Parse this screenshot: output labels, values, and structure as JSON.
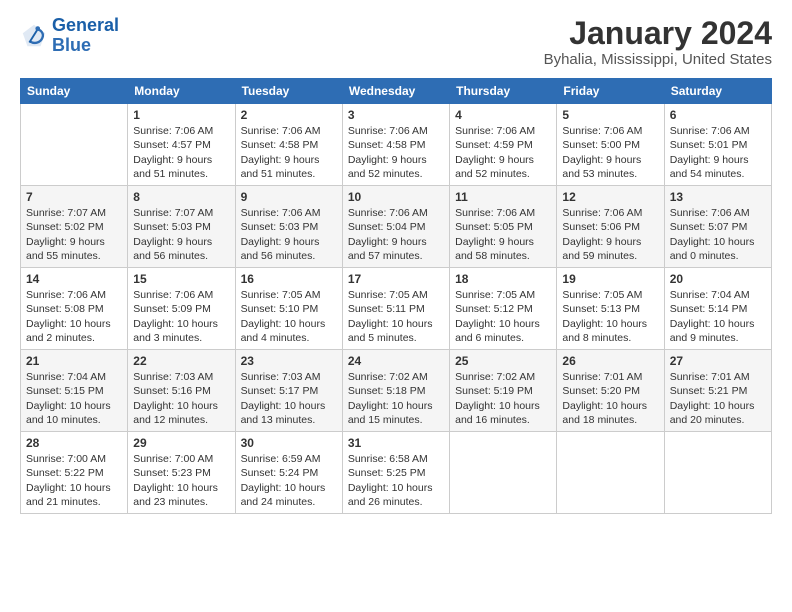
{
  "header": {
    "logo_line1": "General",
    "logo_line2": "Blue",
    "title": "January 2024",
    "subtitle": "Byhalia, Mississippi, United States"
  },
  "days_of_week": [
    "Sunday",
    "Monday",
    "Tuesday",
    "Wednesday",
    "Thursday",
    "Friday",
    "Saturday"
  ],
  "weeks": [
    [
      {
        "day": "",
        "sunrise": "",
        "sunset": "",
        "daylight": ""
      },
      {
        "day": "1",
        "sunrise": "Sunrise: 7:06 AM",
        "sunset": "Sunset: 4:57 PM",
        "daylight": "Daylight: 9 hours and 51 minutes."
      },
      {
        "day": "2",
        "sunrise": "Sunrise: 7:06 AM",
        "sunset": "Sunset: 4:58 PM",
        "daylight": "Daylight: 9 hours and 51 minutes."
      },
      {
        "day": "3",
        "sunrise": "Sunrise: 7:06 AM",
        "sunset": "Sunset: 4:58 PM",
        "daylight": "Daylight: 9 hours and 52 minutes."
      },
      {
        "day": "4",
        "sunrise": "Sunrise: 7:06 AM",
        "sunset": "Sunset: 4:59 PM",
        "daylight": "Daylight: 9 hours and 52 minutes."
      },
      {
        "day": "5",
        "sunrise": "Sunrise: 7:06 AM",
        "sunset": "Sunset: 5:00 PM",
        "daylight": "Daylight: 9 hours and 53 minutes."
      },
      {
        "day": "6",
        "sunrise": "Sunrise: 7:06 AM",
        "sunset": "Sunset: 5:01 PM",
        "daylight": "Daylight: 9 hours and 54 minutes."
      }
    ],
    [
      {
        "day": "7",
        "sunrise": "Sunrise: 7:07 AM",
        "sunset": "Sunset: 5:02 PM",
        "daylight": "Daylight: 9 hours and 55 minutes."
      },
      {
        "day": "8",
        "sunrise": "Sunrise: 7:07 AM",
        "sunset": "Sunset: 5:03 PM",
        "daylight": "Daylight: 9 hours and 56 minutes."
      },
      {
        "day": "9",
        "sunrise": "Sunrise: 7:06 AM",
        "sunset": "Sunset: 5:03 PM",
        "daylight": "Daylight: 9 hours and 56 minutes."
      },
      {
        "day": "10",
        "sunrise": "Sunrise: 7:06 AM",
        "sunset": "Sunset: 5:04 PM",
        "daylight": "Daylight: 9 hours and 57 minutes."
      },
      {
        "day": "11",
        "sunrise": "Sunrise: 7:06 AM",
        "sunset": "Sunset: 5:05 PM",
        "daylight": "Daylight: 9 hours and 58 minutes."
      },
      {
        "day": "12",
        "sunrise": "Sunrise: 7:06 AM",
        "sunset": "Sunset: 5:06 PM",
        "daylight": "Daylight: 9 hours and 59 minutes."
      },
      {
        "day": "13",
        "sunrise": "Sunrise: 7:06 AM",
        "sunset": "Sunset: 5:07 PM",
        "daylight": "Daylight: 10 hours and 0 minutes."
      }
    ],
    [
      {
        "day": "14",
        "sunrise": "Sunrise: 7:06 AM",
        "sunset": "Sunset: 5:08 PM",
        "daylight": "Daylight: 10 hours and 2 minutes."
      },
      {
        "day": "15",
        "sunrise": "Sunrise: 7:06 AM",
        "sunset": "Sunset: 5:09 PM",
        "daylight": "Daylight: 10 hours and 3 minutes."
      },
      {
        "day": "16",
        "sunrise": "Sunrise: 7:05 AM",
        "sunset": "Sunset: 5:10 PM",
        "daylight": "Daylight: 10 hours and 4 minutes."
      },
      {
        "day": "17",
        "sunrise": "Sunrise: 7:05 AM",
        "sunset": "Sunset: 5:11 PM",
        "daylight": "Daylight: 10 hours and 5 minutes."
      },
      {
        "day": "18",
        "sunrise": "Sunrise: 7:05 AM",
        "sunset": "Sunset: 5:12 PM",
        "daylight": "Daylight: 10 hours and 6 minutes."
      },
      {
        "day": "19",
        "sunrise": "Sunrise: 7:05 AM",
        "sunset": "Sunset: 5:13 PM",
        "daylight": "Daylight: 10 hours and 8 minutes."
      },
      {
        "day": "20",
        "sunrise": "Sunrise: 7:04 AM",
        "sunset": "Sunset: 5:14 PM",
        "daylight": "Daylight: 10 hours and 9 minutes."
      }
    ],
    [
      {
        "day": "21",
        "sunrise": "Sunrise: 7:04 AM",
        "sunset": "Sunset: 5:15 PM",
        "daylight": "Daylight: 10 hours and 10 minutes."
      },
      {
        "day": "22",
        "sunrise": "Sunrise: 7:03 AM",
        "sunset": "Sunset: 5:16 PM",
        "daylight": "Daylight: 10 hours and 12 minutes."
      },
      {
        "day": "23",
        "sunrise": "Sunrise: 7:03 AM",
        "sunset": "Sunset: 5:17 PM",
        "daylight": "Daylight: 10 hours and 13 minutes."
      },
      {
        "day": "24",
        "sunrise": "Sunrise: 7:02 AM",
        "sunset": "Sunset: 5:18 PM",
        "daylight": "Daylight: 10 hours and 15 minutes."
      },
      {
        "day": "25",
        "sunrise": "Sunrise: 7:02 AM",
        "sunset": "Sunset: 5:19 PM",
        "daylight": "Daylight: 10 hours and 16 minutes."
      },
      {
        "day": "26",
        "sunrise": "Sunrise: 7:01 AM",
        "sunset": "Sunset: 5:20 PM",
        "daylight": "Daylight: 10 hours and 18 minutes."
      },
      {
        "day": "27",
        "sunrise": "Sunrise: 7:01 AM",
        "sunset": "Sunset: 5:21 PM",
        "daylight": "Daylight: 10 hours and 20 minutes."
      }
    ],
    [
      {
        "day": "28",
        "sunrise": "Sunrise: 7:00 AM",
        "sunset": "Sunset: 5:22 PM",
        "daylight": "Daylight: 10 hours and 21 minutes."
      },
      {
        "day": "29",
        "sunrise": "Sunrise: 7:00 AM",
        "sunset": "Sunset: 5:23 PM",
        "daylight": "Daylight: 10 hours and 23 minutes."
      },
      {
        "day": "30",
        "sunrise": "Sunrise: 6:59 AM",
        "sunset": "Sunset: 5:24 PM",
        "daylight": "Daylight: 10 hours and 24 minutes."
      },
      {
        "day": "31",
        "sunrise": "Sunrise: 6:58 AM",
        "sunset": "Sunset: 5:25 PM",
        "daylight": "Daylight: 10 hours and 26 minutes."
      },
      {
        "day": "",
        "sunrise": "",
        "sunset": "",
        "daylight": ""
      },
      {
        "day": "",
        "sunrise": "",
        "sunset": "",
        "daylight": ""
      },
      {
        "day": "",
        "sunrise": "",
        "sunset": "",
        "daylight": ""
      }
    ]
  ]
}
